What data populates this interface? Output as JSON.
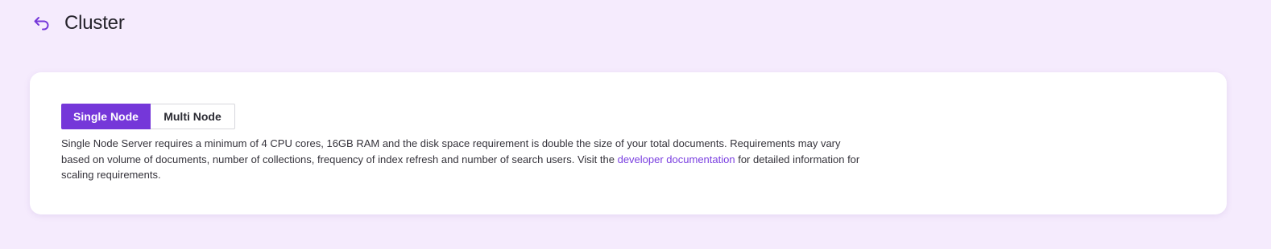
{
  "header": {
    "back_icon": "back-arrow-icon",
    "title": "Cluster"
  },
  "colors": {
    "background": "#f5ebfd",
    "accent": "#7537d9",
    "link": "#7a3fe0"
  },
  "mode_toggle": {
    "selected": "Single Node",
    "options": [
      {
        "label": "Single Node"
      },
      {
        "label": "Multi Node"
      }
    ]
  },
  "description": {
    "before_link": "Single Node Server requires a minimum of 4 CPU cores, 16GB RAM and the disk space requirement is double the size of your total documents. Requirements may vary based on volume of documents, number of collections, frequency of index refresh and number of search users. Visit the",
    "link_text": "developer documentation",
    "after_link": "for detailed information for scaling requirements."
  }
}
